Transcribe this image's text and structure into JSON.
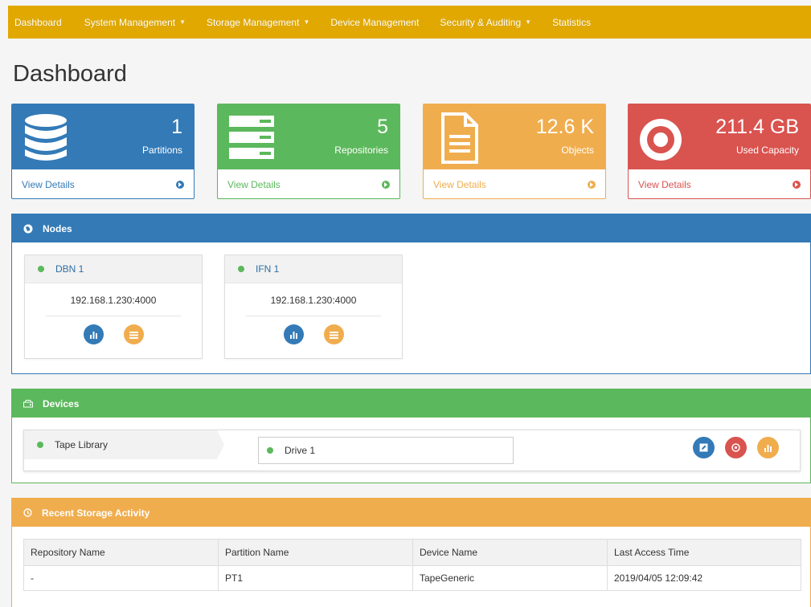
{
  "navbar": {
    "items": [
      {
        "label": "Dashboard",
        "dropdown": false
      },
      {
        "label": "System Management",
        "dropdown": true
      },
      {
        "label": "Storage Management",
        "dropdown": true
      },
      {
        "label": "Device Management",
        "dropdown": false
      },
      {
        "label": "Security & Auditing",
        "dropdown": true
      },
      {
        "label": "Statistics",
        "dropdown": false
      }
    ],
    "color": "#e0a800"
  },
  "page": {
    "title": "Dashboard"
  },
  "stats": [
    {
      "value": "1",
      "label": "Partitions",
      "link": "View Details",
      "color": "#337ab7",
      "icon": "database-icon"
    },
    {
      "value": "5",
      "label": "Repositories",
      "link": "View Details",
      "color": "#5cb85c",
      "icon": "server-icon"
    },
    {
      "value": "12.6 K",
      "label": "Objects",
      "link": "View Details",
      "color": "#f0ad4e",
      "icon": "document-icon"
    },
    {
      "value": "211.4 GB",
      "label": "Used Capacity",
      "link": "View Details",
      "color": "#d9534f",
      "icon": "target-icon"
    }
  ],
  "nodes_panel": {
    "title": "Nodes",
    "color": "#337ab7",
    "nodes": [
      {
        "name": "DBN 1",
        "ip": "192.168.1.230:4000",
        "status": "online"
      },
      {
        "name": "IFN 1",
        "ip": "192.168.1.230:4000",
        "status": "online"
      }
    ]
  },
  "devices_panel": {
    "title": "Devices",
    "color": "#5cb85c",
    "library": {
      "name": "Tape Library",
      "status": "online"
    },
    "drive": {
      "name": "Drive 1",
      "status": "online"
    }
  },
  "activity_panel": {
    "title": "Recent Storage Activity",
    "color": "#f0ad4e",
    "columns": [
      "Repository Name",
      "Partition Name",
      "Device Name",
      "Last Access Time"
    ],
    "rows": [
      {
        "repository": "-",
        "partition": "PT1",
        "device": "TapeGeneric",
        "last_access": "2019/04/05 12:09:42"
      }
    ]
  }
}
